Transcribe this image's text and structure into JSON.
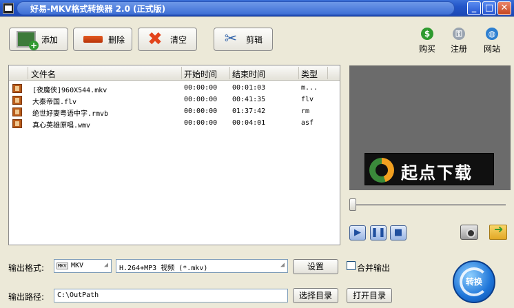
{
  "window": {
    "title": "好易-MKV格式转换器 2.0 (正式版)"
  },
  "toolbar": {
    "add_label": "添加",
    "delete_label": "删除",
    "clear_label": "清空",
    "cut_label": "剪辑",
    "buy_label": "购买",
    "register_label": "注册",
    "website_label": "网站"
  },
  "file_list": {
    "columns": [
      "文件名",
      "开始时间",
      "结束时间",
      "类型"
    ],
    "rows": [
      {
        "name": "[夜魔侠]960X544.mkv",
        "start": "00:00:00",
        "end": "00:01:03",
        "type": "m..."
      },
      {
        "name": "大秦帝国.flv",
        "start": "00:00:00",
        "end": "00:41:35",
        "type": "flv"
      },
      {
        "name": "绝世好妻粤语中字.rmvb",
        "start": "00:00:00",
        "end": "01:37:42",
        "type": "rm"
      },
      {
        "name": "真心英雄原唱.wmv",
        "start": "00:00:00",
        "end": "00:04:01",
        "type": "asf"
      }
    ]
  },
  "preview": {
    "logo_text": "起点下载",
    "seek_fraction": 0.0
  },
  "player": {
    "play_icon": "play-icon",
    "pause_icon": "pause-icon",
    "stop_icon": "stop-icon"
  },
  "output": {
    "format_label": "输出格式:",
    "format_value": "MKV",
    "format_badge": "MKV",
    "codec_value": "H.264+MP3 视频 (*.mkv)",
    "settings_label": "设置",
    "merge_label": "合并输出",
    "merge_checked": false,
    "path_label": "输出路径:",
    "path_value": "C:\\OutPath",
    "choose_dir_label": "选择目录",
    "open_dir_label": "打开目录",
    "convert_label": "转换"
  },
  "colors": {
    "titlebar": "#2356c9",
    "preview_bg": "#6b6b6b",
    "convert": "#1d74d8"
  }
}
